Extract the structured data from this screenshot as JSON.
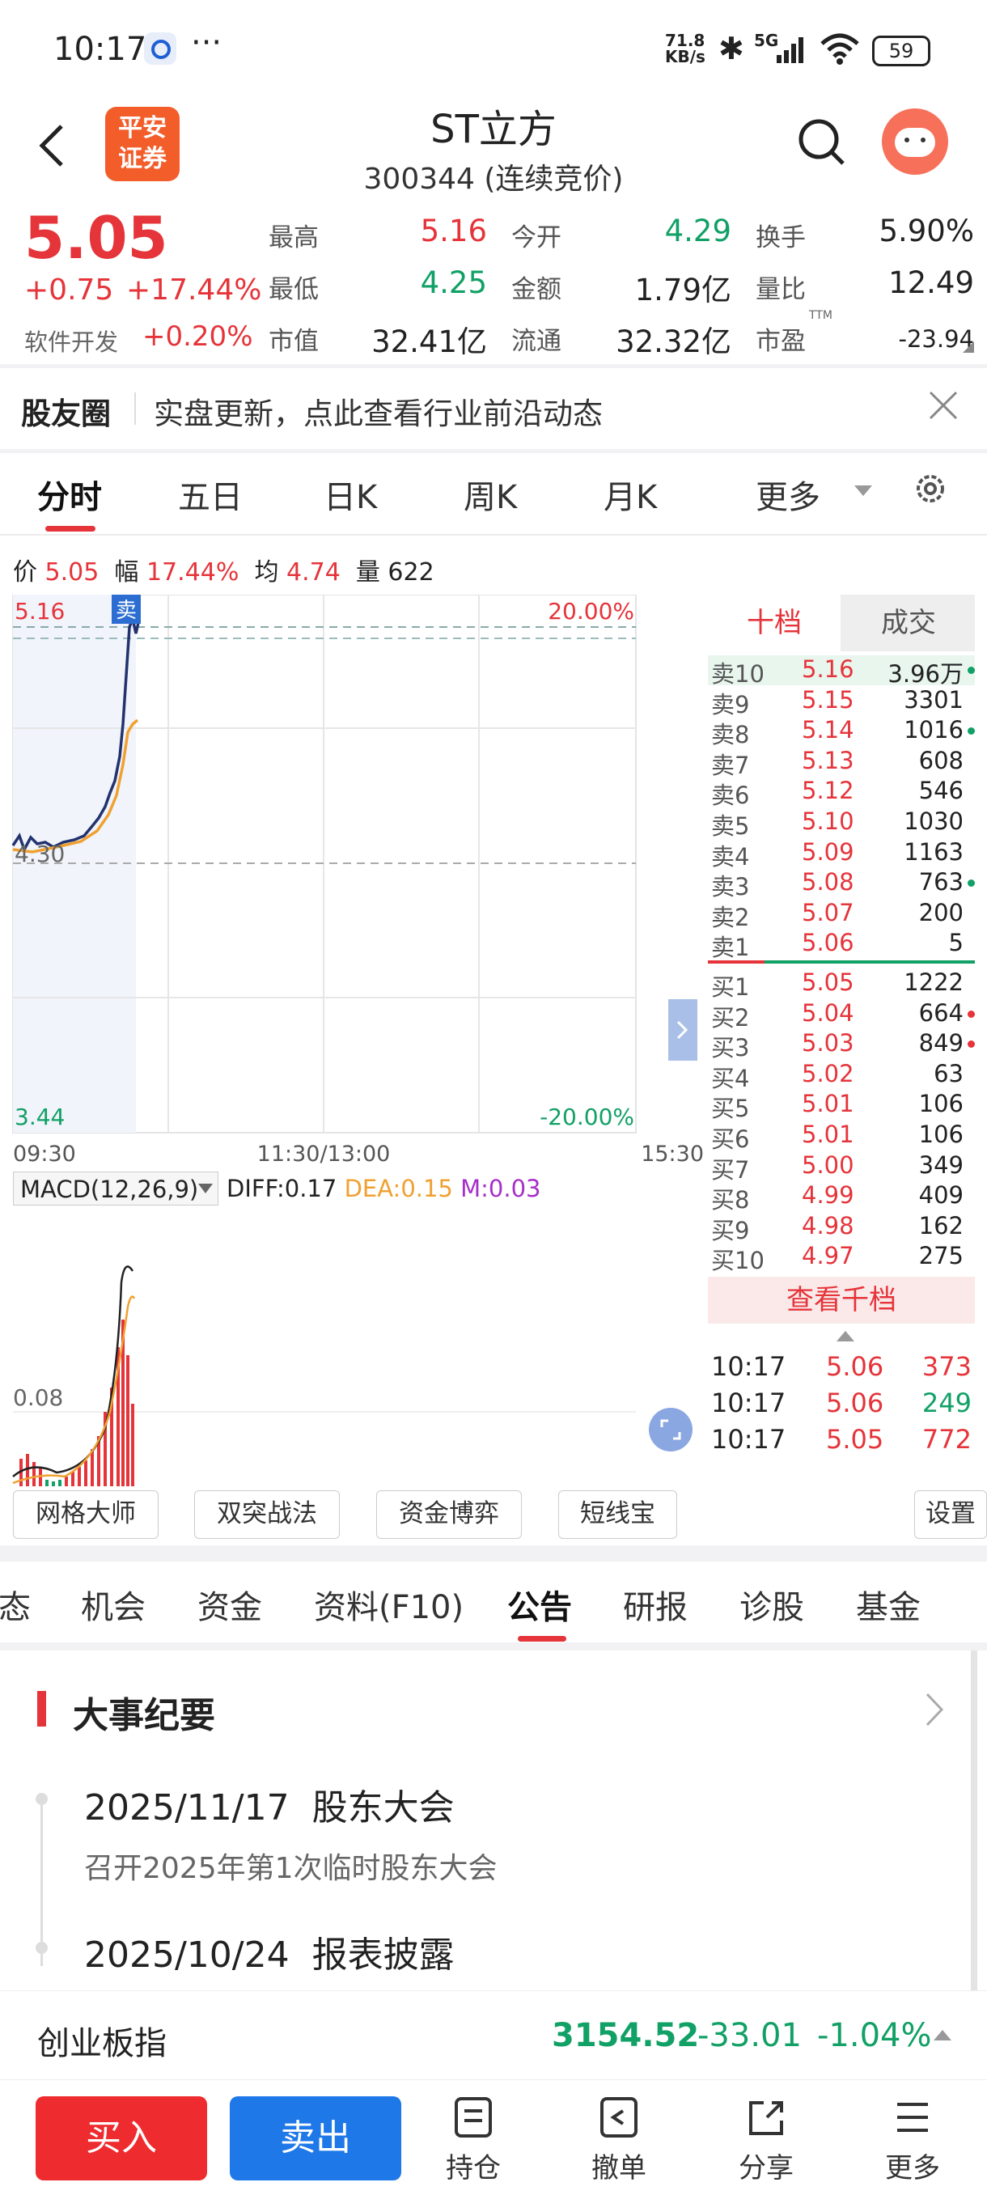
{
  "status_bar": {
    "time": "10:17",
    "network_speed_top": "71.8",
    "network_speed_unit": "KB/s",
    "signal": "5G",
    "battery": "59"
  },
  "header": {
    "title": "ST立方",
    "subtitle": "300344 (连续竞价)",
    "broker_logo_line1": "平安",
    "broker_logo_line2": "证券"
  },
  "quote": {
    "price": "5.05",
    "change": "+0.75",
    "change_pct": "+17.44%",
    "sector_name": "软件开发",
    "sector_change": "+0.20%",
    "stats": [
      {
        "label": "最高",
        "value": "5.16",
        "color": "red"
      },
      {
        "label": "今开",
        "value": "4.29",
        "color": "green"
      },
      {
        "label": "换手",
        "value": "5.90%",
        "color": "black"
      },
      {
        "label": "最低",
        "value": "4.25",
        "color": "green"
      },
      {
        "label": "金额",
        "value": "1.79亿",
        "color": "black"
      },
      {
        "label": "量比",
        "value": "12.49",
        "color": "black"
      },
      {
        "label": "市值",
        "value": "32.41亿",
        "color": "black"
      },
      {
        "label": "流通",
        "value": "32.32亿",
        "color": "black"
      },
      {
        "label": "市盈",
        "value": "-23.94",
        "color": "black"
      }
    ],
    "pe_superscript": "TTM"
  },
  "feed": {
    "label": "股友圈",
    "text": "实盘更新，点此查看行业前沿动态"
  },
  "chart_tabs": [
    "分时",
    "五日",
    "日K",
    "周K",
    "月K",
    "更多"
  ],
  "info_line": {
    "price_label": "价",
    "price": "5.05",
    "amp_label": "幅",
    "amp": "17.44%",
    "avg_label": "均",
    "avg": "4.74",
    "vol_label": "量",
    "vol": "622"
  },
  "chart_labels": {
    "y_top": "5.16",
    "y_mid": "4.30",
    "y_bottom": "3.44",
    "pct_top": "20.00%",
    "pct_bottom": "-20.00%",
    "sell_marker": "卖",
    "time_start": "09:30",
    "time_mid": "11:30/13:00",
    "time_end": "15:30"
  },
  "macd": {
    "title": "MACD(12,26,9)",
    "diff": "DIFF:0.17",
    "dea": "DEA:0.15",
    "m": "M:0.03",
    "y_label": "0.08"
  },
  "orderbook": {
    "tab_active": "十档",
    "tab_other": "成交",
    "asks": [
      {
        "label": "卖10",
        "price": "5.16",
        "vol": "3.96万",
        "dot": "green"
      },
      {
        "label": "卖9",
        "price": "5.15",
        "vol": "3301",
        "dot": ""
      },
      {
        "label": "卖8",
        "price": "5.14",
        "vol": "1016",
        "dot": "green"
      },
      {
        "label": "卖7",
        "price": "5.13",
        "vol": "608",
        "dot": ""
      },
      {
        "label": "卖6",
        "price": "5.12",
        "vol": "546",
        "dot": ""
      },
      {
        "label": "卖5",
        "price": "5.10",
        "vol": "1030",
        "dot": ""
      },
      {
        "label": "卖4",
        "price": "5.09",
        "vol": "1163",
        "dot": ""
      },
      {
        "label": "卖3",
        "price": "5.08",
        "vol": "763",
        "dot": "green"
      },
      {
        "label": "卖2",
        "price": "5.07",
        "vol": "200",
        "dot": ""
      },
      {
        "label": "卖1",
        "price": "5.06",
        "vol": "5",
        "dot": ""
      }
    ],
    "bids": [
      {
        "label": "买1",
        "price": "5.05",
        "vol": "1222",
        "dot": ""
      },
      {
        "label": "买2",
        "price": "5.04",
        "vol": "664",
        "dot": "red"
      },
      {
        "label": "买3",
        "price": "5.03",
        "vol": "849",
        "dot": "red"
      },
      {
        "label": "买4",
        "price": "5.02",
        "vol": "63",
        "dot": ""
      },
      {
        "label": "买5",
        "price": "5.01",
        "vol": "106",
        "dot": ""
      },
      {
        "label": "买6",
        "price": "5.01",
        "vol": "106",
        "dot": ""
      },
      {
        "label": "买7",
        "price": "5.00",
        "vol": "349",
        "dot": ""
      },
      {
        "label": "买8",
        "price": "4.99",
        "vol": "409",
        "dot": ""
      },
      {
        "label": "买9",
        "price": "4.98",
        "vol": "162",
        "dot": ""
      },
      {
        "label": "买10",
        "price": "4.97",
        "vol": "275",
        "dot": ""
      }
    ],
    "view_more": "查看千档",
    "trades": [
      {
        "time": "10:17",
        "price": "5.06",
        "vol": "373",
        "color": "red"
      },
      {
        "time": "10:17",
        "price": "5.06",
        "vol": "249",
        "color": "green"
      },
      {
        "time": "10:17",
        "price": "5.05",
        "vol": "772",
        "color": "red"
      }
    ]
  },
  "tools": [
    "网格大师",
    "双突战法",
    "资金博弈",
    "短线宝",
    "设置"
  ],
  "bottom_tabs": [
    "态",
    "机会",
    "资金",
    "资料(F10)",
    "公告",
    "研报",
    "诊股",
    "基金"
  ],
  "events": {
    "title": "大事纪要",
    "items": [
      {
        "date": "2025/11/17",
        "type": "股东大会",
        "desc": "召开2025年第1次临时股东大会"
      },
      {
        "date": "2025/10/24",
        "type": "报表披露",
        "desc": ""
      }
    ]
  },
  "index_bar": {
    "name": "创业板指",
    "value": "3154.52",
    "change": "-33.01",
    "pct": "-1.04%"
  },
  "actions": {
    "buy": "买入",
    "sell": "卖出",
    "items": [
      "持仓",
      "撤单",
      "分享",
      "更多"
    ]
  }
}
